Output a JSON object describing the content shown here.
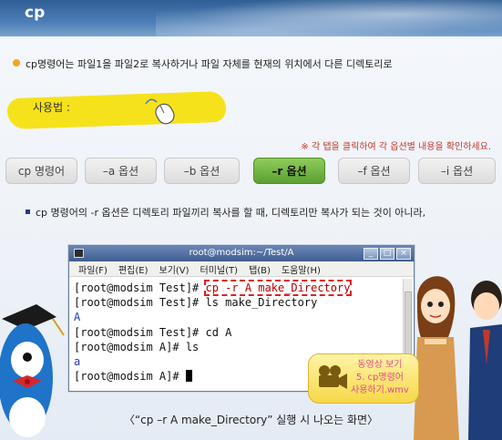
{
  "page": {
    "title": "cp"
  },
  "description": "cp명령어는 파일1을 파일2로 복사하거나 파일 자체를 현재의 위치에서 다른 디렉토리로",
  "usage": {
    "label": "사용법 :"
  },
  "hint": "※ 각 탭을 클릭하여 각 옵션별 내용을 확인하세요.",
  "tabs": [
    {
      "label": "cp 명령어",
      "active": false
    },
    {
      "label": "–a 옵션",
      "active": false
    },
    {
      "label": "–b 옵션",
      "active": false
    },
    {
      "label": "–r 옵션",
      "active": true
    },
    {
      "label": "–f 옵션",
      "active": false
    },
    {
      "label": "–i 옵션",
      "active": false
    }
  ],
  "bullet": "cp 명령어의 -r 옵션은 디렉토리 파일끼리 복사를 할 때, 디렉토리만 복사가 되는 것이 아니라,",
  "terminal": {
    "title": "root@modsim:~/Test/A",
    "window_buttons": [
      "_",
      "□",
      "×"
    ],
    "menu": [
      "파일(F)",
      "편집(E)",
      "보기(V)",
      "터미널(T)",
      "탭(B)",
      "도움말(H)"
    ],
    "lines": [
      {
        "prompt": "[root@modsim Test]# ",
        "cmd": "cp -r A make_Directory"
      },
      {
        "prompt": "[root@modsim Test]# ",
        "cmd": "ls make_Directory"
      },
      {
        "output": "A"
      },
      {
        "prompt": "[root@modsim Test]# ",
        "cmd": "cd A"
      },
      {
        "prompt": "[root@modsim A]# ",
        "cmd": "ls"
      },
      {
        "output": "a"
      },
      {
        "prompt": "[root@modsim A]# ",
        "cmd": ""
      }
    ]
  },
  "caption": "〈“cp –r  A  make_Directory” 실행 시 나오는 화면〉",
  "video": {
    "text": "동영상 보기\n5. cp명령어\n사용하기.wmv"
  },
  "colors": {
    "header": "#3f6ea6",
    "tab_active": "#6fb23f",
    "highlight_border": "#e02020",
    "output_text": "#1a3fc8",
    "badge": "#f6d847"
  }
}
